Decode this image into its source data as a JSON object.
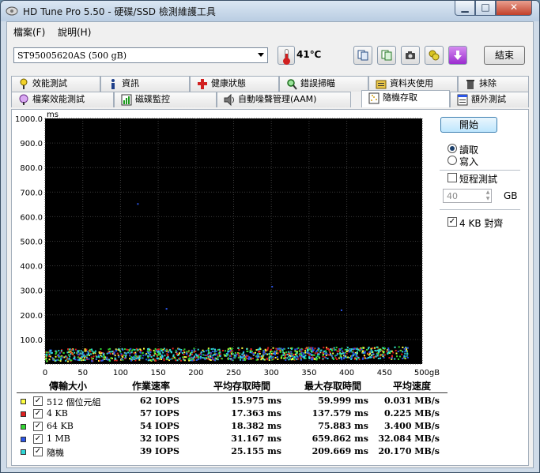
{
  "window": {
    "title": "HD Tune Pro 5.50 - 硬碟/SSD 檢測維護工具"
  },
  "menu": [
    {
      "label": "檔案(F)"
    },
    {
      "label": "說明(H)"
    }
  ],
  "toolbar": {
    "drive": "ST95005620AS (500 gB)",
    "temperature": "41℃",
    "exit_label": "結束"
  },
  "tabs_row1": [
    {
      "label": "效能測試",
      "icon": "benchmark-icon"
    },
    {
      "label": "資訊",
      "icon": "info-icon"
    },
    {
      "label": "健康狀態",
      "icon": "health-icon"
    },
    {
      "label": "錯誤掃瞄",
      "icon": "error-scan-icon"
    },
    {
      "label": "資料夾使用",
      "icon": "folder-usage-icon"
    },
    {
      "label": "抹除",
      "icon": "erase-icon"
    }
  ],
  "tabs_row2": [
    {
      "label": "檔案效能測試",
      "icon": "file-benchmark-icon"
    },
    {
      "label": "磁碟監控",
      "icon": "disk-monitor-icon"
    },
    {
      "label": "自動噪聲管理(AAM)",
      "icon": "speaker-icon"
    },
    {
      "label": "隨機存取",
      "icon": "random-access-icon",
      "active": true
    },
    {
      "label": "額外測試",
      "icon": "extra-tests-icon"
    }
  ],
  "side": {
    "start": "開始",
    "read": "讀取",
    "write": "寫入",
    "short_test": "短程測試",
    "short_size": "40",
    "gb": "GB",
    "align": "4 KB 對齊"
  },
  "chart_data": {
    "type": "scatter",
    "ylabel": "ms",
    "ylim": [
      0,
      1000
    ],
    "xlim": [
      0,
      500
    ],
    "y_ticks": [
      "1000.0",
      "900.0",
      "800.0",
      "700.0",
      "600.0",
      "500.0",
      "400.0",
      "300.0",
      "200.0",
      "100.0"
    ],
    "x_ticks": [
      "0",
      "50",
      "100",
      "150",
      "200",
      "250",
      "300",
      "350",
      "400",
      "450",
      "500gB"
    ],
    "series": [
      {
        "name": "512 個位元組",
        "color": "#ffff40",
        "band": [
          10,
          60
        ]
      },
      {
        "name": "4 KB",
        "color": "#e02020",
        "band": [
          10,
          60
        ]
      },
      {
        "name": "64 KB",
        "color": "#33d633",
        "band": [
          10,
          60
        ]
      },
      {
        "name": "1 MB",
        "color": "#2c56e8",
        "band": [
          10,
          60
        ]
      },
      {
        "name": "隨機",
        "color": "#30d6d6",
        "band": [
          10,
          60
        ]
      }
    ]
  },
  "table": {
    "headers": [
      "傳輸大小",
      "作業速率",
      "平均存取時間",
      "最大存取時間",
      "平均速度"
    ],
    "rows": [
      {
        "name": "512 個位元組",
        "color": "#ffff40",
        "rate": "62 IOPS",
        "avg": "15.975 ms",
        "max": "59.999 ms",
        "speed": "0.031 MB/s"
      },
      {
        "name": "4 KB",
        "color": "#e02020",
        "rate": "57 IOPS",
        "avg": "17.363 ms",
        "max": "137.579 ms",
        "speed": "0.225 MB/s"
      },
      {
        "name": "64 KB",
        "color": "#33d633",
        "rate": "54 IOPS",
        "avg": "18.382 ms",
        "max": "75.883 ms",
        "speed": "3.400 MB/s"
      },
      {
        "name": "1 MB",
        "color": "#2c56e8",
        "rate": "32 IOPS",
        "avg": "31.167 ms",
        "max": "659.862 ms",
        "speed": "32.084 MB/s"
      },
      {
        "name": "隨機",
        "color": "#30d6d6",
        "rate": "39 IOPS",
        "avg": "25.155 ms",
        "max": "209.669 ms",
        "speed": "20.170 MB/s"
      }
    ]
  }
}
